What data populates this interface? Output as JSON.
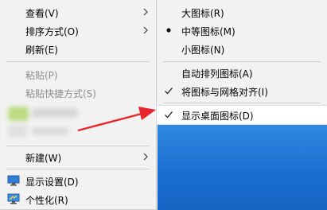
{
  "main_menu": {
    "view": "查看(V)",
    "sort_by": "排序方式(O)",
    "refresh": "刷新(E)",
    "paste": "粘贴(P)",
    "paste_shortcut": "粘贴快捷方式(S)",
    "new": "新建(W)",
    "display_settings": "显示设置(D)",
    "personalize": "个性化(R)"
  },
  "view_submenu": {
    "large_icons": "大图标(R)",
    "medium_icons": "中等图标(M)",
    "small_icons": "小图标(N)",
    "auto_arrange": "自动排列图标(A)",
    "align_to_grid": "将图标与网格对齐(I)",
    "show_desktop_icons": "显示桌面图标(D)",
    "selected_size": "中等图标(M)",
    "checked": [
      "将图标与网格对齐(I)",
      "显示桌面图标(D)"
    ]
  },
  "colors": {
    "menu_bg": "#f2f2f2",
    "disabled_text": "#8d8d8d",
    "arrow_red": "#e8262b",
    "desktop_blue": "#1b6fd0"
  },
  "icons": {
    "submenu_arrow": "chevron-right-icon",
    "selected_bullet": "bullet-icon",
    "checkmark": "checkmark-icon",
    "display_settings": "monitor-icon",
    "personalize": "personalize-icon",
    "annotation": "red-arrow-icon"
  }
}
